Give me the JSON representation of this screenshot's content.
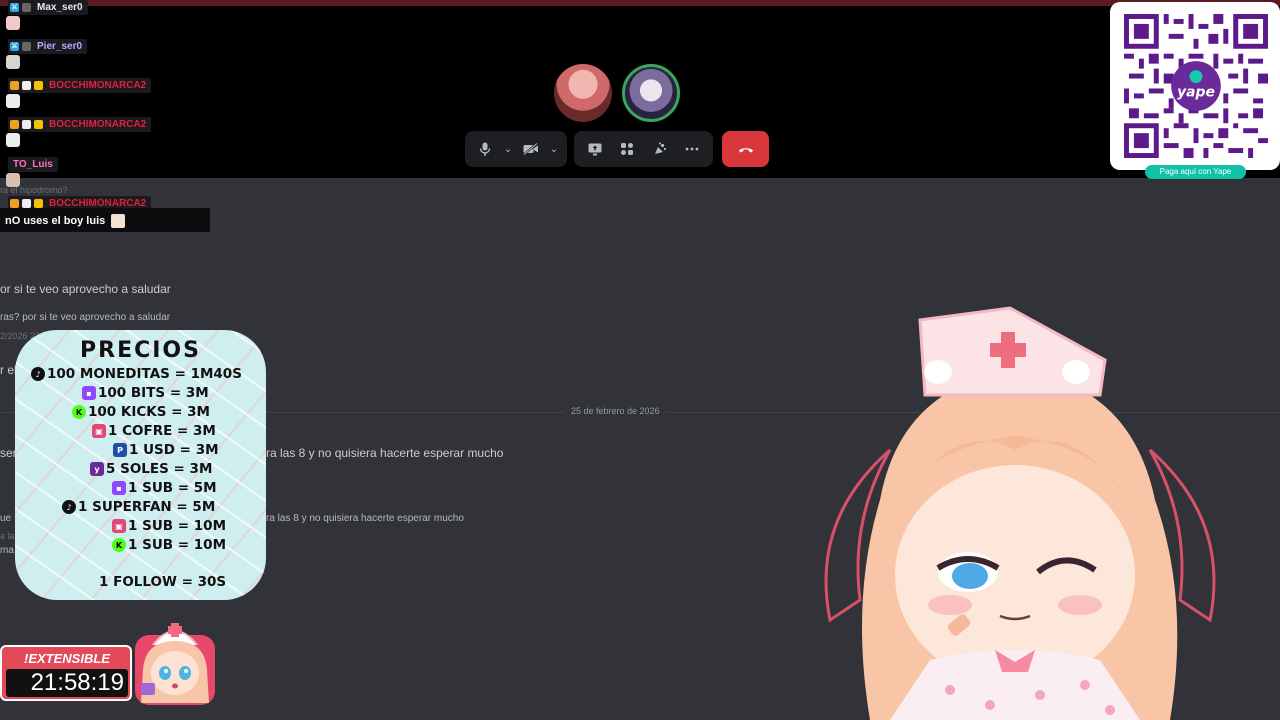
{
  "call": {
    "controls": {
      "mic_icon": "microphone-icon",
      "camera_icon": "camera-off-icon",
      "screen_icon": "screen-share-icon",
      "activities_icon": "activities-icon",
      "soundboard_icon": "soundboard-icon",
      "more_icon": "more-icon",
      "hangup_icon": "phone-hangup-icon"
    }
  },
  "discord_chat": {
    "line1": "ra el hipodromo?",
    "line2": "or si te veo aprovecho a saludar",
    "line3": "ras? por si te veo aprovecho a saludar",
    "line3_time": "2/2026 22:44",
    "line4": "r el",
    "date_separator": "25 de febrero de 2026",
    "line5_left": "ser",
    "line5": "ra las 8 y no quisiera hacerte esperar mucho",
    "line6_left": "ue",
    "line6": "ra las 8 y no quisiera hacerte esperar mucho",
    "line7_left": "a las",
    "line8_left": "ma"
  },
  "stream_chat": {
    "messages": [
      {
        "name": "Max_ser0",
        "color": "#e9e6f5"
      },
      {
        "name": "Pier_ser0",
        "color": "#b9a9ff"
      },
      {
        "name": "BOCCHIMONARCA2",
        "color": "#e0203a"
      },
      {
        "name": "BOCCHIMONARCA2",
        "color": "#e0203a"
      },
      {
        "name": "TO_Luis",
        "color": "#ff6fb8"
      },
      {
        "name": "BOCCHIMONARCA2",
        "color": "#e0203a"
      }
    ],
    "last_text": "nO uses el boy luis"
  },
  "prices": {
    "title": "PRECIOS",
    "rows": [
      {
        "icon": "tiktok-icon",
        "text": "100 MONEDITAS = 1M40S"
      },
      {
        "icon": "twitch-icon",
        "text": "100 BITS = 3M"
      },
      {
        "icon": "kick-icon",
        "text": "100 KICKS = 3M"
      },
      {
        "icon": "chest-icon",
        "text": "1 COFRE = 3M"
      },
      {
        "icon": "paypal-icon",
        "text": "1 USD = 3M"
      },
      {
        "icon": "yape-icon",
        "text": "5 SOLES = 3M"
      },
      {
        "icon": "twitch-icon",
        "text": "1 SUB = 5M"
      },
      {
        "icon": "tiktok-icon",
        "text": "1 SUPERFAN = 5M"
      },
      {
        "icon": "chest-icon",
        "text": "1 SUB = 10M"
      },
      {
        "icon": "kick-icon",
        "text": "1 SUB = 10M"
      },
      {
        "icon": "",
        "text": "1 FOLLOW = 30S"
      }
    ]
  },
  "qr": {
    "caption": "Paga aquí con Yape",
    "logo_text": "yape"
  },
  "timer": {
    "label": "!EXTENSIBLE",
    "value": "21:58:19"
  }
}
